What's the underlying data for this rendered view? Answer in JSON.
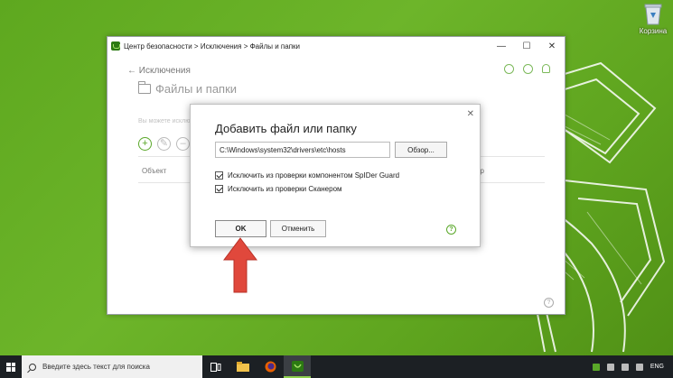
{
  "desktop": {
    "recycle_bin_label": "Корзина"
  },
  "window": {
    "title": "Центр безопасности > Исключения > Файлы и папки",
    "controls": {
      "minimize": "—",
      "maximize": "☐",
      "close": "✕"
    },
    "back_label": "Исключения",
    "page_title": "Файлы и папки",
    "description": "Вы можете исключить определенные файлы и папки из проверки компонентами защиты",
    "table": {
      "col_object": "Объект",
      "col_right": "ор"
    },
    "help": "?"
  },
  "dialog": {
    "title": "Добавить файл или папку",
    "close": "✕",
    "path_value": "C:\\Windows\\system32\\drivers\\etc\\hosts",
    "browse_label": "Обзор...",
    "check1_label": "Исключить из проверки компонентом SpIDer Guard",
    "check2_label": "Исключить из проверки Сканером",
    "ok_label": "OK",
    "cancel_label": "Отменить",
    "help": "?"
  },
  "taskbar": {
    "search_placeholder": "Введите здесь текст для поиска",
    "lang": "ENG"
  },
  "colors": {
    "accent_green": "#5aa829",
    "arrow_red": "#e0483c",
    "desktop_green": "#66ae24"
  }
}
